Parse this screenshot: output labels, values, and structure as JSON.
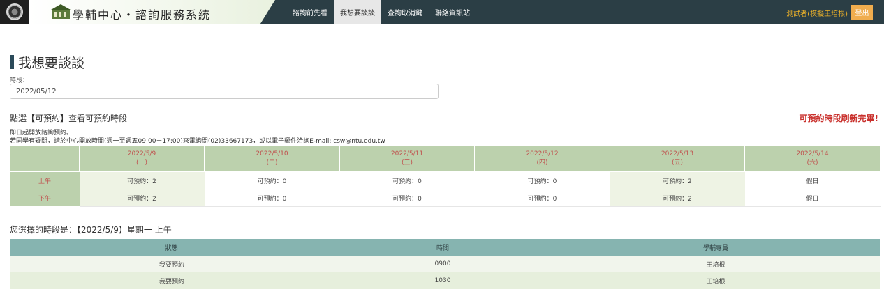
{
  "header": {
    "brand_title": "學輔中心‧諮詢服務系統",
    "nav": [
      {
        "label": "諮詢前先看",
        "active": false
      },
      {
        "label": "我想要談談",
        "active": true
      },
      {
        "label": "查詢取消鍵",
        "active": false
      },
      {
        "label": "聯絡資訊站",
        "active": false
      }
    ],
    "user_name": "測試者(模擬王培根)",
    "logout_label": "登出"
  },
  "page": {
    "title": "我想要談談",
    "period_label": "時段：",
    "date_value": "2022/05/12"
  },
  "schedule": {
    "heading": "點選【可預約】查看可預約時段",
    "refresh_status": "可預約時段刷新完畢!",
    "notice1": "即日起開放諮詢預約。",
    "notice2": "若同學有疑問，請於中心開放時間(週一至週五09:00－17:00)來電詢問(02)33667173，或以電子郵件洽詢E-mail: csw@ntu.edu.tw",
    "days": [
      {
        "date": "2022/5/9",
        "weekday": "(一)"
      },
      {
        "date": "2022/5/10",
        "weekday": "(二)"
      },
      {
        "date": "2022/5/11",
        "weekday": "(三)"
      },
      {
        "date": "2022/5/12",
        "weekday": "(四)"
      },
      {
        "date": "2022/5/13",
        "weekday": "(五)"
      },
      {
        "date": "2022/5/14",
        "weekday": "(六)"
      }
    ],
    "rows": [
      {
        "period": "上午",
        "cells": [
          "可預約：2",
          "可預約：0",
          "可預約：0",
          "可預約：0",
          "可預約：2",
          "假日"
        ]
      },
      {
        "period": "下午",
        "cells": [
          "可預約：2",
          "可預約：0",
          "可預約：0",
          "可預約：0",
          "可預約：2",
          "假日"
        ]
      }
    ]
  },
  "selection": {
    "heading": "您選擇的時段是：【2022/5/9】星期一 上午",
    "columns": [
      "狀態",
      "時間",
      "學輔專員"
    ],
    "rows": [
      {
        "status": "我要預約",
        "time": "0900",
        "staff": "王培根"
      },
      {
        "status": "我要預約",
        "time": "1030",
        "staff": "王培根"
      }
    ]
  },
  "colors": {
    "topbar": "#2b3e45",
    "table_header": "#bcd1ad",
    "slots_header": "#86b4b0",
    "accent_red": "#c9302c",
    "logout": "#f0ad4e"
  }
}
